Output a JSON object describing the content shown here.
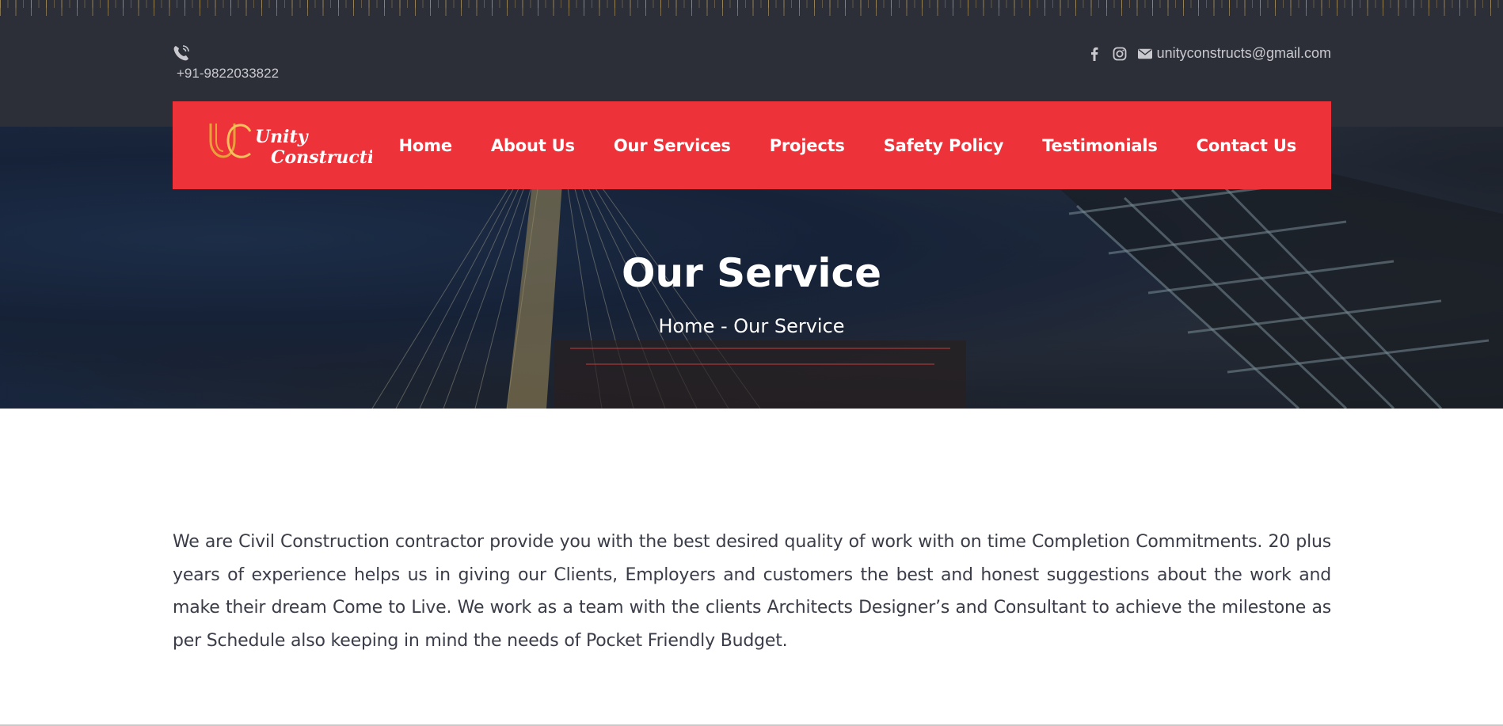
{
  "topbar": {
    "phone_icon": "phone-icon",
    "phone": "+91-9822033822",
    "social": [
      {
        "icon": "facebook-icon"
      },
      {
        "icon": "instagram-icon"
      }
    ],
    "email_icon": "envelope-icon",
    "email": "unityconstructs@gmail.com"
  },
  "navbar": {
    "background": "#ee323a",
    "logo": {
      "monogram": "UC",
      "line1": "Unity",
      "line2": "Construction",
      "monogram_color": "#e8a13a"
    },
    "items": [
      {
        "label": "Home"
      },
      {
        "label": "About Us"
      },
      {
        "label": "Our Services"
      },
      {
        "label": "Projects"
      },
      {
        "label": "Safety Policy"
      },
      {
        "label": "Testimonials"
      },
      {
        "label": "Contact Us"
      }
    ]
  },
  "hero": {
    "title": "Our Service",
    "breadcrumb": {
      "home": "Home",
      "separator": " - ",
      "current": "Our Service"
    }
  },
  "content": {
    "paragraph": "We are Civil Construction contractor provide you with the best desired quality of work with on time Completion Commitments. 20 plus years of experience helps us in giving our Clients, Employers and customers the best and honest suggestions about the work and make their dream Come to Live. We work as a team with the clients Architects Designer’s and Consultant to achieve the milestone as per Schedule also keeping in mind the needs of Pocket Friendly Budget."
  }
}
